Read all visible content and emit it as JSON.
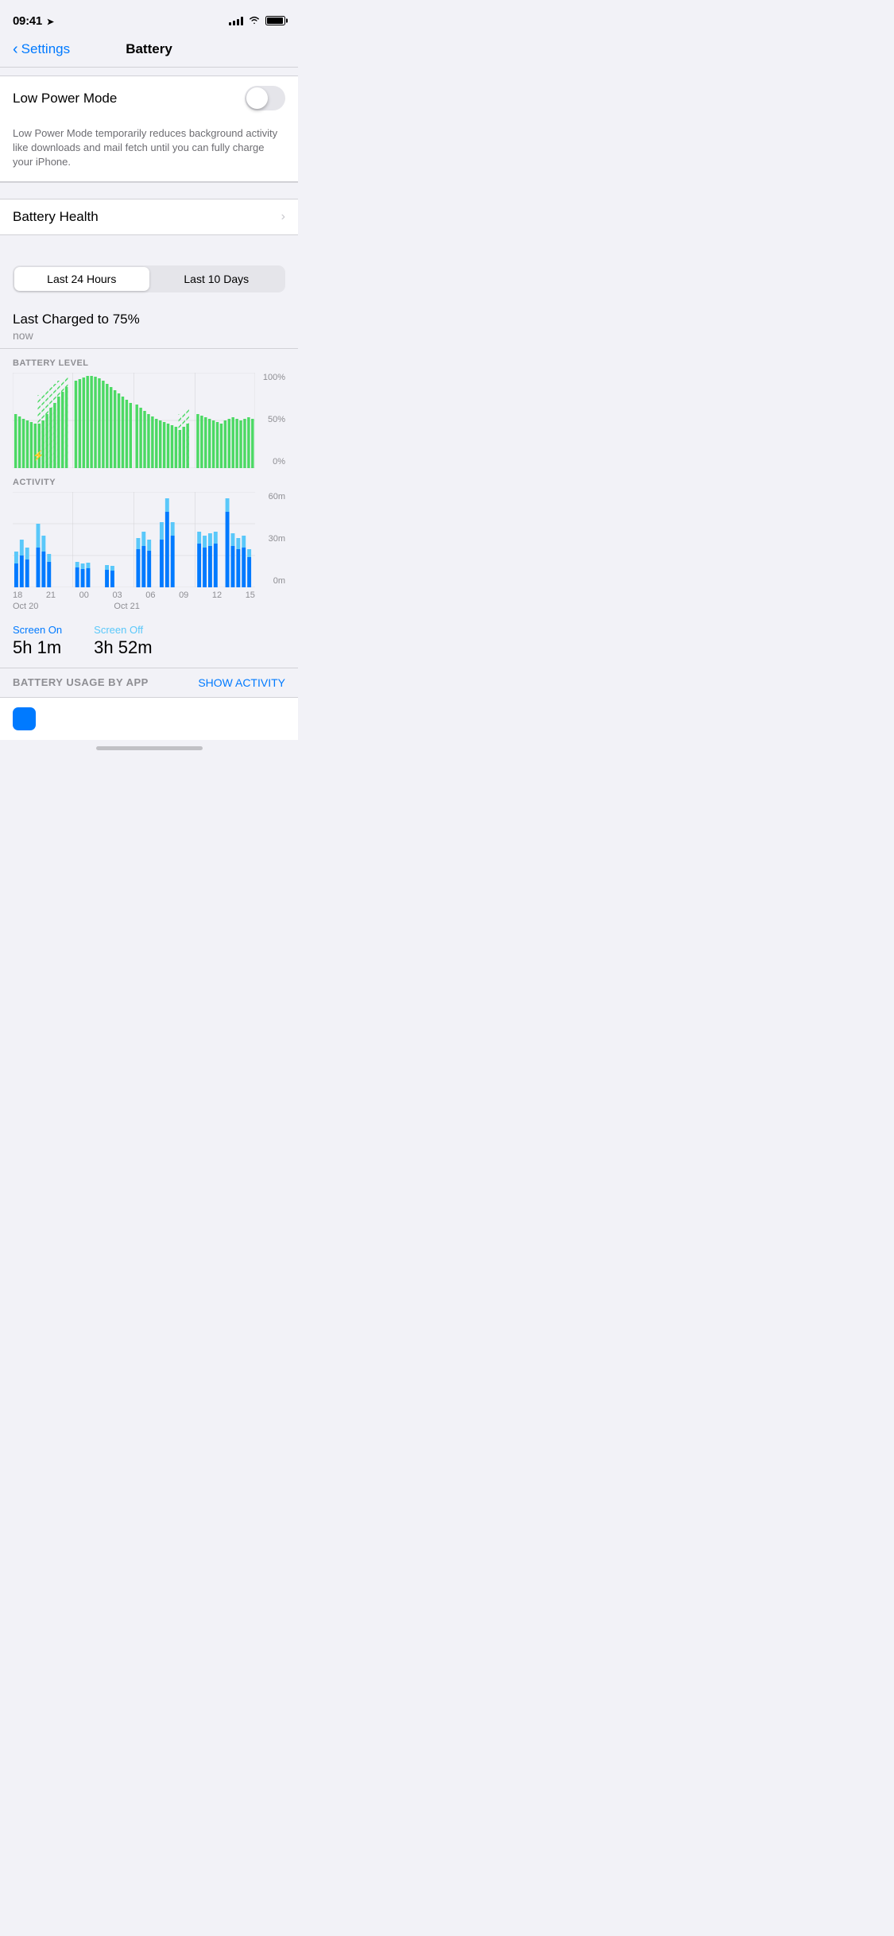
{
  "statusBar": {
    "time": "09:41",
    "locationArrow": "➤"
  },
  "navBar": {
    "backLabel": "Settings",
    "title": "Battery"
  },
  "settings": {
    "lowPowerMode": {
      "label": "Low Power Mode",
      "enabled": false
    },
    "lowPowerDescription": "Low Power Mode temporarily reduces background activity like downloads and mail fetch until you can fully charge your iPhone.",
    "batteryHealth": {
      "label": "Battery Health",
      "chevron": "›"
    }
  },
  "segmentControl": {
    "option1": "Last 24 Hours",
    "option2": "Last 10 Days",
    "activeIndex": 0
  },
  "lastCharged": {
    "title": "Last Charged to 75%",
    "subtitle": "now"
  },
  "batteryChart": {
    "label": "BATTERY LEVEL",
    "yLabels": [
      "100%",
      "50%",
      "0%"
    ]
  },
  "activityChart": {
    "label": "ACTIVITY",
    "yLabels": [
      "60m",
      "30m",
      "0m"
    ]
  },
  "timeLabels": [
    "18",
    "21",
    "00",
    "03",
    "06",
    "09",
    "12",
    "15"
  ],
  "dateLabels": {
    "date1": "Oct 20",
    "date2": "Oct 21"
  },
  "screenStats": {
    "onLabel": "Screen On",
    "onValue": "5h 1m",
    "offLabel": "Screen Off",
    "offValue": "3h 52m"
  },
  "usageSection": {
    "label": "BATTERY USAGE BY APP",
    "action": "SHOW ACTIVITY"
  }
}
